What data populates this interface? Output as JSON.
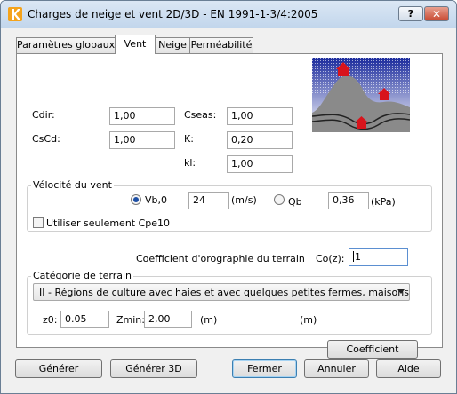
{
  "window": {
    "title": "Charges de neige et vent 2D/3D - EN 1991-1-3/4:2005",
    "help_label": "?",
    "close_label": "✕"
  },
  "tabs": [
    {
      "label": "Paramètres globaux"
    },
    {
      "label": "Vent"
    },
    {
      "label": "Neige"
    },
    {
      "label": "Perméabilité"
    }
  ],
  "params": {
    "cdir_label": "Cdir:",
    "cdir_value": "1,00",
    "cscd_label": "CsCd:",
    "cscd_value": "1,00",
    "cseas_label": "Cseas:",
    "cseas_value": "1,00",
    "k_label": "K:",
    "k_value": "0,20",
    "kl_label": "kl:",
    "kl_value": "1,00"
  },
  "velocity": {
    "group_title": "Vélocité du vent",
    "vb_label": "Vb,0",
    "vb_value": "24",
    "vb_unit": "(m/s)",
    "qb_label": "Qb",
    "qb_value": "0,36",
    "qb_unit": "(kPa)",
    "cpe_label": "Utiliser seulement Cpe10",
    "selected": "Vb,0"
  },
  "orography": {
    "label": "Coefficient d'orographie du terrain",
    "coz_label": "Co(z):",
    "coz_value": "1"
  },
  "terrain": {
    "group_title": "Catégorie de terrain",
    "category_value": "II - Régions de culture avec haies et avec quelques petites fermes, maisons ou arl",
    "z0_label": "z0:",
    "z0_value": "0.05",
    "zmin_label": "Zmin:",
    "zmin_value": "2,00",
    "unit_m": "(m)",
    "unit_m2": "(m)"
  },
  "coefficient_button": "Coefficient",
  "footer": {
    "generate": "Générer",
    "generate3d": "Générer 3D",
    "close": "Fermer",
    "cancel": "Annuler",
    "help": "Aide"
  },
  "colors": {
    "accent_radio": "#1d4fa5",
    "house": "#d8141c",
    "sky_top": "#1a2a9c"
  }
}
